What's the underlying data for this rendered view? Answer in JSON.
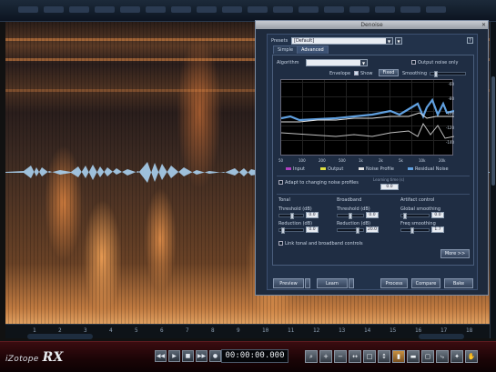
{
  "timecode": "00:00:00.000",
  "logo": {
    "brand": "iZotope",
    "product": "RX"
  },
  "ruler": {
    "ticks": [
      "1",
      "2",
      "3",
      "4",
      "5",
      "6",
      "7",
      "8",
      "9",
      "10",
      "11",
      "12",
      "13",
      "14",
      "15",
      "16",
      "17",
      "18"
    ]
  },
  "dialog": {
    "title": "Denoise",
    "presets_label": "Presets",
    "presets_value": "[Default]",
    "tabs": [
      "Simple",
      "Advanced"
    ],
    "help": "?",
    "algorithm_label": "Algorithm",
    "output_noise_only": "Output noise only",
    "envelope_label": "Envelope",
    "show_label": "Show",
    "fixed_label": "Fixed",
    "smoothing_label": "Smoothing",
    "db_ticks": [
      "-60",
      "-80",
      "-100",
      "-120",
      "-140"
    ],
    "freq_ticks": [
      "50",
      "100",
      "200",
      "500",
      "1k",
      "2k",
      "5k",
      "10k",
      "20k"
    ],
    "legend": [
      {
        "label": "Input",
        "color": "#b040c0"
      },
      {
        "label": "Output",
        "color": "#e0e040"
      },
      {
        "label": "Noise Profile",
        "color": "#e0e0e0"
      },
      {
        "label": "Residual Noise",
        "color": "#60a0e0"
      }
    ],
    "adaptive_label": "Adapt to changing noise profiles",
    "learning_label": "Learning time (s)",
    "learning_value": "0.0",
    "tonal": {
      "title": "Tonal",
      "threshold": "Threshold (dB)",
      "threshold_val": "0.0",
      "reduction": "Reduction (dB)",
      "reduction_val": "0.0"
    },
    "broadband": {
      "title": "Broadband",
      "threshold": "Threshold (dB)",
      "threshold_val": "0.0",
      "reduction": "Reduction (dB)",
      "reduction_val": "20.0"
    },
    "artifact": {
      "title": "Artifact control",
      "global": "Global smoothing",
      "global_val": "0.0",
      "freq": "Freq smoothing",
      "freq_val": "1.7"
    },
    "link_label": "Link tonal and broadband controls",
    "more_button": "More >>",
    "buttons": [
      "Preview",
      "Learn",
      "Process",
      "Compare",
      "Bake"
    ]
  },
  "colors": {
    "accent": "#d08040",
    "waveform": "#a8d0f0",
    "dialog_bg": "#22324a"
  }
}
